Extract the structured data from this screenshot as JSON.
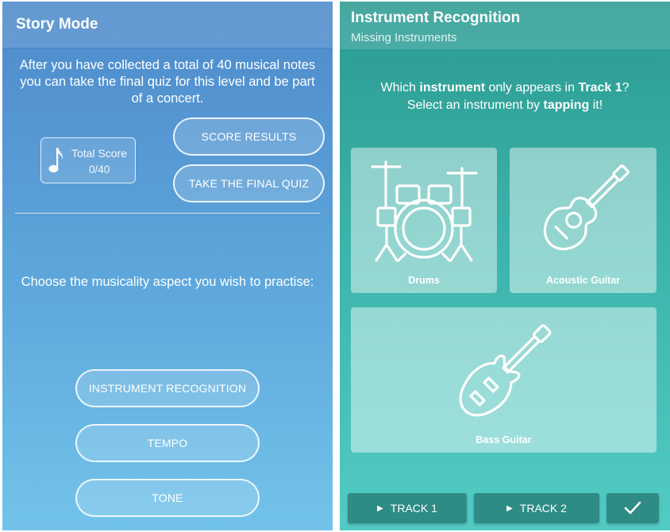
{
  "story": {
    "title": "Story Mode",
    "intro": "After you have collected a total of 40 musical notes you can take the final quiz for this level and be part of a concert.",
    "score_label": "Total Score",
    "score_value": "0/40",
    "score_results_button": "SCORE RESULTS",
    "final_quiz_button": "TAKE THE FINAL QUIZ",
    "choose_text": "Choose the musicality aspect you wish to practise:",
    "aspects": [
      "INSTRUMENT RECOGNITION",
      "TEMPO",
      "TONE"
    ]
  },
  "recognition": {
    "title": "Instrument Recognition",
    "subtitle": "Missing Instruments",
    "question": {
      "p1": "Which ",
      "b1": "instrument",
      "p2": " only appears in ",
      "b2": "Track 1",
      "p3": "?",
      "p4": "Select an instrument by ",
      "b3": "tapping",
      "p5": " it!"
    },
    "instruments": [
      {
        "label": "Drums",
        "icon": "drum-kit-icon"
      },
      {
        "label": "Acoustic Guitar",
        "icon": "acoustic-guitar-icon"
      },
      {
        "label": "Bass Guitar",
        "icon": "bass-guitar-icon"
      }
    ],
    "tracks": [
      "TRACK 1",
      "TRACK 2"
    ],
    "confirm_icon": "checkmark-icon",
    "play_icon": "play-icon"
  },
  "colors": {
    "story_bg_top": "#4e8acb",
    "story_bg_bottom": "#72c3ea",
    "recognition_bg_top": "#2a9a91",
    "recognition_bg_bottom": "#52cbc4",
    "track_button": "#2e8c85"
  }
}
